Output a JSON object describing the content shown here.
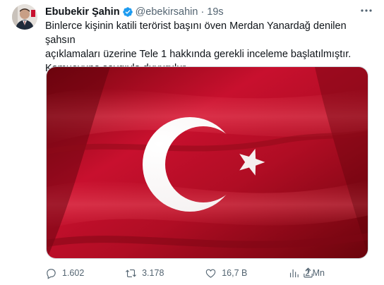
{
  "author": {
    "name": "Ebubekir Şahin",
    "handle": "@ebekirsahin",
    "separator": "·",
    "time": "19s"
  },
  "tweet": {
    "line1": "Binlerce kişinin katili terörist başını öven Merdan Yanardağ denilen şahsın",
    "line2": "açıklamaları üzerine Tele 1 hakkında gerekli inceleme başlatılmıştır.",
    "line3": "Kamuoyuna saygıyla duyurulur."
  },
  "media": {
    "description": "turkish-flag-image"
  },
  "actions": {
    "replies": "1.602",
    "retweets": "3.178",
    "likes": "16,7 B",
    "views": "2 Mn"
  },
  "colors": {
    "flag_red": "#c8102e",
    "icon_gray": "#536471",
    "verified_blue": "#1d9bf0"
  }
}
